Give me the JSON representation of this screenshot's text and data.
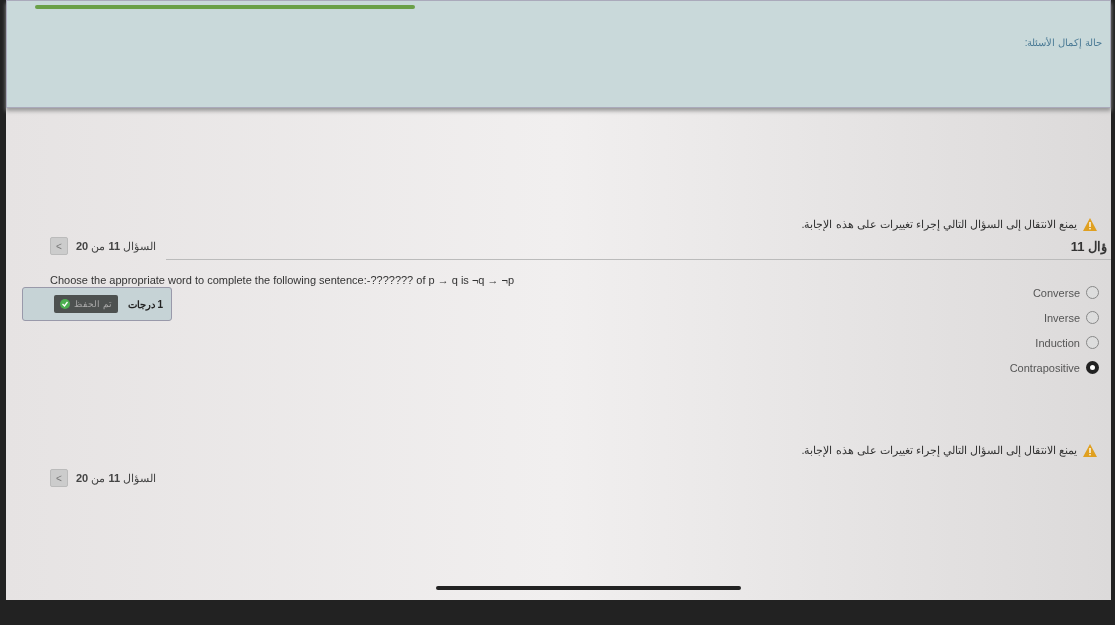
{
  "header": {
    "completion_status": "حالة إكمال الأسئلة:"
  },
  "top_warning": "يمنع الانتقال إلى السؤال التالي إجراء تغييرات على هذه الإجابة.",
  "top_nav": {
    "label": "السؤال **11** من **20**",
    "button": "<"
  },
  "question": {
    "number": "ؤال 11",
    "grade": "1 درجات",
    "saved_badge": "تم الحفظ",
    "text": "Choose the appropriate word to complete the following sentence:-??????? of p → q is ¬q → ¬p",
    "options": [
      {
        "label": "Converse",
        "selected": false
      },
      {
        "label": "Inverse",
        "selected": false
      },
      {
        "label": "Induction",
        "selected": false
      },
      {
        "label": "Contrapositive",
        "selected": true
      }
    ]
  },
  "bottom_warning": "يمنع الانتقال إلى السؤال التالي إجراء تغييرات على هذه الإجابة.",
  "bottom_nav": {
    "label": "السؤال **11** من **20**",
    "button": "<"
  }
}
